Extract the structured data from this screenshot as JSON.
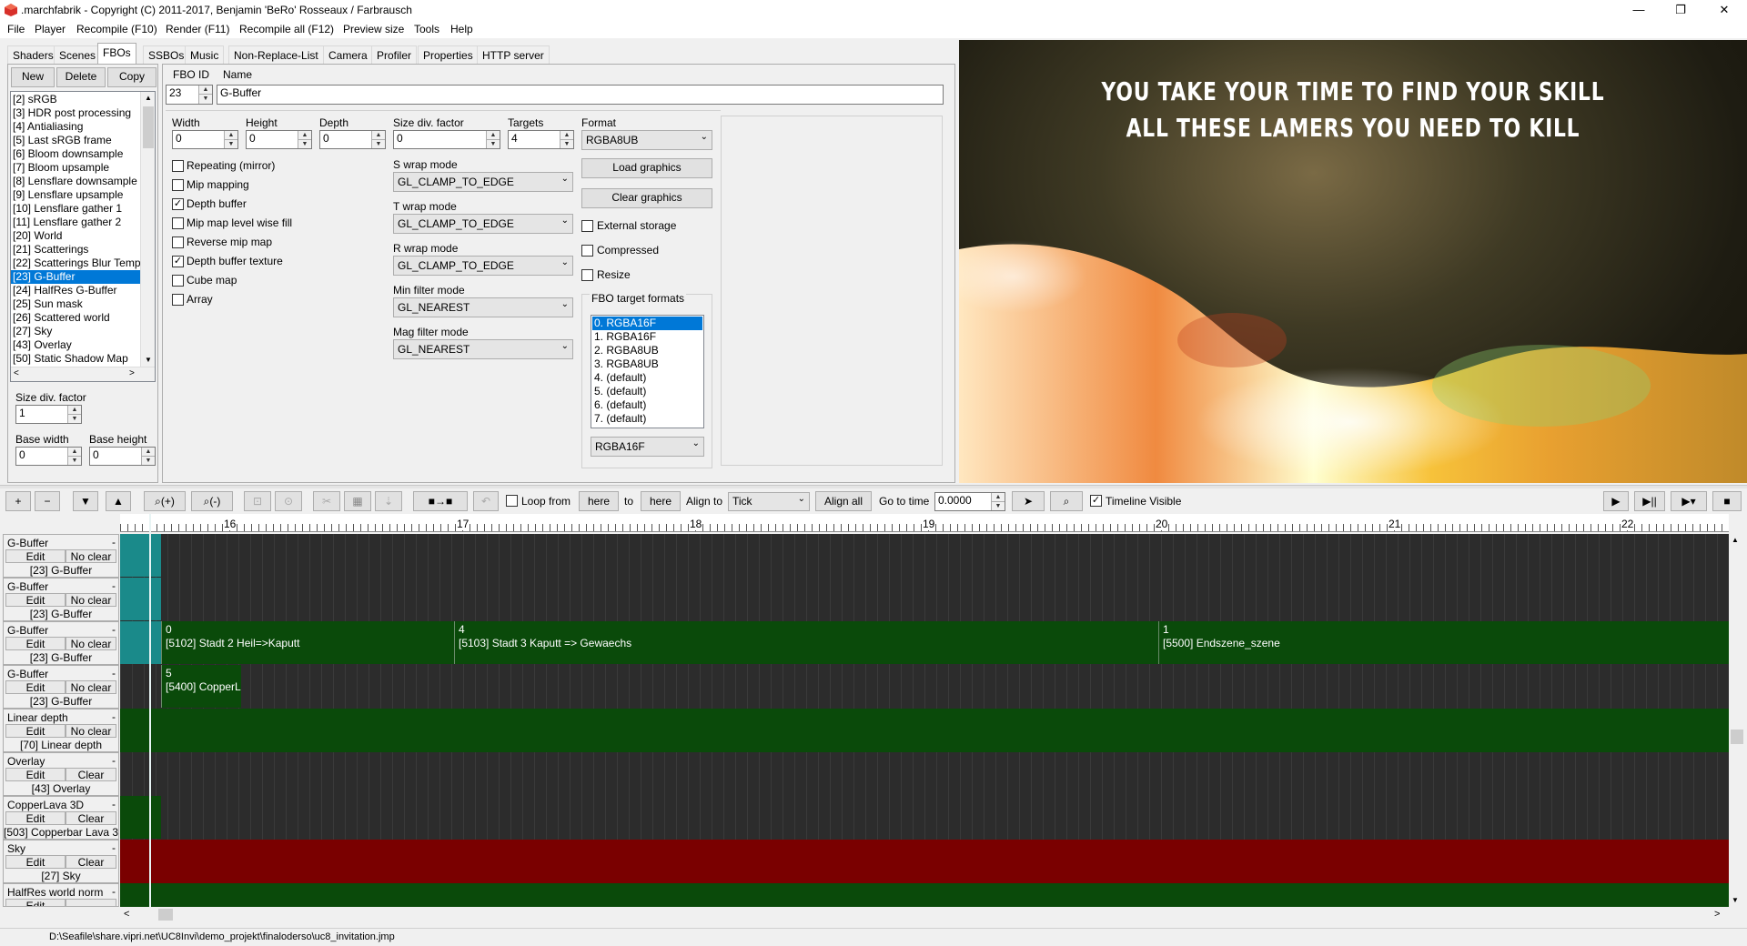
{
  "window": {
    "title": ".marchfabrik - Copyright (C) 2011-2017, Benjamin 'BeRo' Rosseaux / Farbrausch",
    "minimize": "—",
    "maximize": "❐",
    "close": "✕"
  },
  "menu": [
    "File",
    "Player",
    "Recompile (F10)",
    "Render (F11)",
    "Recompile all (F12)",
    "Preview size",
    "Tools",
    "Help"
  ],
  "tabs": [
    "Shaders",
    "Scenes",
    "FBOs",
    "SSBOs",
    "Music",
    "Non-Replace-List",
    "Camera",
    "Profiler",
    "Properties",
    "HTTP server"
  ],
  "active_tab": "FBOs",
  "fbo_list": {
    "buttons": {
      "new": "New",
      "delete": "Delete",
      "copy": "Copy"
    },
    "items": [
      "[2] sRGB",
      "[3] HDR post processing",
      "[4] Antialiasing",
      "[5] Last sRGB frame",
      "[6] Bloom downsample",
      "[7] Bloom upsample",
      "[8] Lensflare downsample",
      "[9] Lensflare upsample",
      "[10] Lensflare gather 1",
      "[11] Lensflare gather 2",
      "[20] World",
      "[21] Scatterings",
      "[22] Scatterings Blur Temp",
      "[23] G-Buffer",
      "[24] HalfRes G-Buffer",
      "[25] Sun mask",
      "[26] Scattered world",
      "[27] Sky",
      "[43] Overlay",
      "[50] Static Shadow Map"
    ],
    "selected": "[23] G-Buffer",
    "size_div_factor_label": "Size div. factor",
    "size_div_factor": "1",
    "base_width_label": "Base width",
    "base_width": "0",
    "base_height_label": "Base height",
    "base_height": "0"
  },
  "fbo": {
    "id_label": "FBO ID",
    "name_label": "Name",
    "id": "23",
    "name": "G-Buffer",
    "width_label": "Width",
    "width": "0",
    "height_label": "Height",
    "height": "0",
    "depth_label": "Depth",
    "depth": "0",
    "sdf_label": "Size div. factor",
    "sdf": "0",
    "targets_label": "Targets",
    "targets": "4",
    "format_label": "Format",
    "format": "RGBA8UB",
    "checkboxes": [
      {
        "label": "Repeating (mirror)",
        "checked": false
      },
      {
        "label": "Mip mapping",
        "checked": false
      },
      {
        "label": "Depth buffer",
        "checked": true
      },
      {
        "label": "Mip map level wise fill",
        "checked": false
      },
      {
        "label": "Reverse mip map",
        "checked": false
      },
      {
        "label": "Depth buffer texture",
        "checked": true
      },
      {
        "label": "Cube map",
        "checked": false
      },
      {
        "label": "Array",
        "checked": false
      }
    ],
    "s_wrap_label": "S wrap mode",
    "s_wrap": "GL_CLAMP_TO_EDGE",
    "t_wrap_label": "T wrap mode",
    "t_wrap": "GL_CLAMP_TO_EDGE",
    "r_wrap_label": "R wrap mode",
    "r_wrap": "GL_CLAMP_TO_EDGE",
    "min_filter_label": "Min filter mode",
    "min_filter": "GL_NEAREST",
    "mag_filter_label": "Mag filter mode",
    "mag_filter": "GL_NEAREST",
    "load_graphics": "Load graphics",
    "clear_graphics": "Clear graphics",
    "external_storage": "External storage",
    "compressed": "Compressed",
    "resize": "Resize",
    "target_formats_label": "FBO target formats",
    "target_formats": [
      "0.  RGBA16F",
      "1.  RGBA16F",
      "2.  RGBA8UB",
      "3.  RGBA8UB",
      "4.  (default)",
      "5.  (default)",
      "6.  (default)",
      "7.  (default)"
    ],
    "target_format_selected": "RGBA16F"
  },
  "preview": {
    "line1": "YOU TAKE YOUR TIME TO FIND YOUR SKILL",
    "line2": "ALL THESE LAMERS YOU NEED TO KILL"
  },
  "timeline_toolbar": {
    "plus": "+",
    "minus": "−",
    "down": "▼",
    "up": "▲",
    "zoom_in": "⌕(+)",
    "zoom_out": "⌕(-)",
    "loop_from": "Loop from",
    "here1": "here",
    "to": "to",
    "here2": "here",
    "align_to": "Align to",
    "align_value": "Tick",
    "align_all": "Align all",
    "go_to_time": "Go to time",
    "time_value": "0.0000",
    "go": "➤",
    "search": "⌕",
    "timeline_visible": "Timeline Visible",
    "play": "▶",
    "play_pause": "▶||",
    "play_menu": "▶▾",
    "stop": "■"
  },
  "ruler": [
    "16",
    "17",
    "18",
    "19",
    "20",
    "21",
    "22"
  ],
  "tracks": [
    {
      "name": "G-Buffer",
      "left": "Edit",
      "right": "No clear",
      "fbo": "[23] G-Buffer"
    },
    {
      "name": "G-Buffer",
      "left": "Edit",
      "right": "No clear",
      "fbo": "[23] G-Buffer"
    },
    {
      "name": "G-Buffer",
      "left": "Edit",
      "right": "No clear",
      "fbo": "[23] G-Buffer"
    },
    {
      "name": "G-Buffer",
      "left": "Edit",
      "right": "No clear",
      "fbo": "[23] G-Buffer"
    },
    {
      "name": "Linear depth",
      "left": "Edit",
      "right": "No clear",
      "fbo": "[70] Linear depth"
    },
    {
      "name": "Overlay",
      "left": "Edit",
      "right": "Clear",
      "fbo": "[43] Overlay"
    },
    {
      "name": "CopperLava 3D",
      "left": "Edit",
      "right": "Clear",
      "fbo": "[503] Copperbar Lava 3"
    },
    {
      "name": "Sky",
      "left": "Edit",
      "right": "Clear",
      "fbo": "[27] Sky"
    },
    {
      "name": "HalfRes world norm",
      "left": "Edit",
      "right": "",
      "fbo": ""
    }
  ],
  "clips": {
    "c1_num": "0",
    "c1_label": "[5102] Stadt 2 Heil=>Kaputt",
    "c2_num": "4",
    "c2_label": "[5103] Stadt 3 Kaputt => Gewaechs",
    "c3_num": "1",
    "c3_label": "[5500] Endszene_szene",
    "c4_num": "5",
    "c4_label": "[5400] CopperL"
  },
  "status": "D:\\Seafile\\share.vipri.net\\UC8Invi\\demo_projekt\\finaloderso\\uc8_invitation.jmp",
  "colors": {
    "selection": "#0078d7",
    "clip_green": "#0a4a0a",
    "sky_red": "#7a0000",
    "teal": "#1a8a8a"
  }
}
